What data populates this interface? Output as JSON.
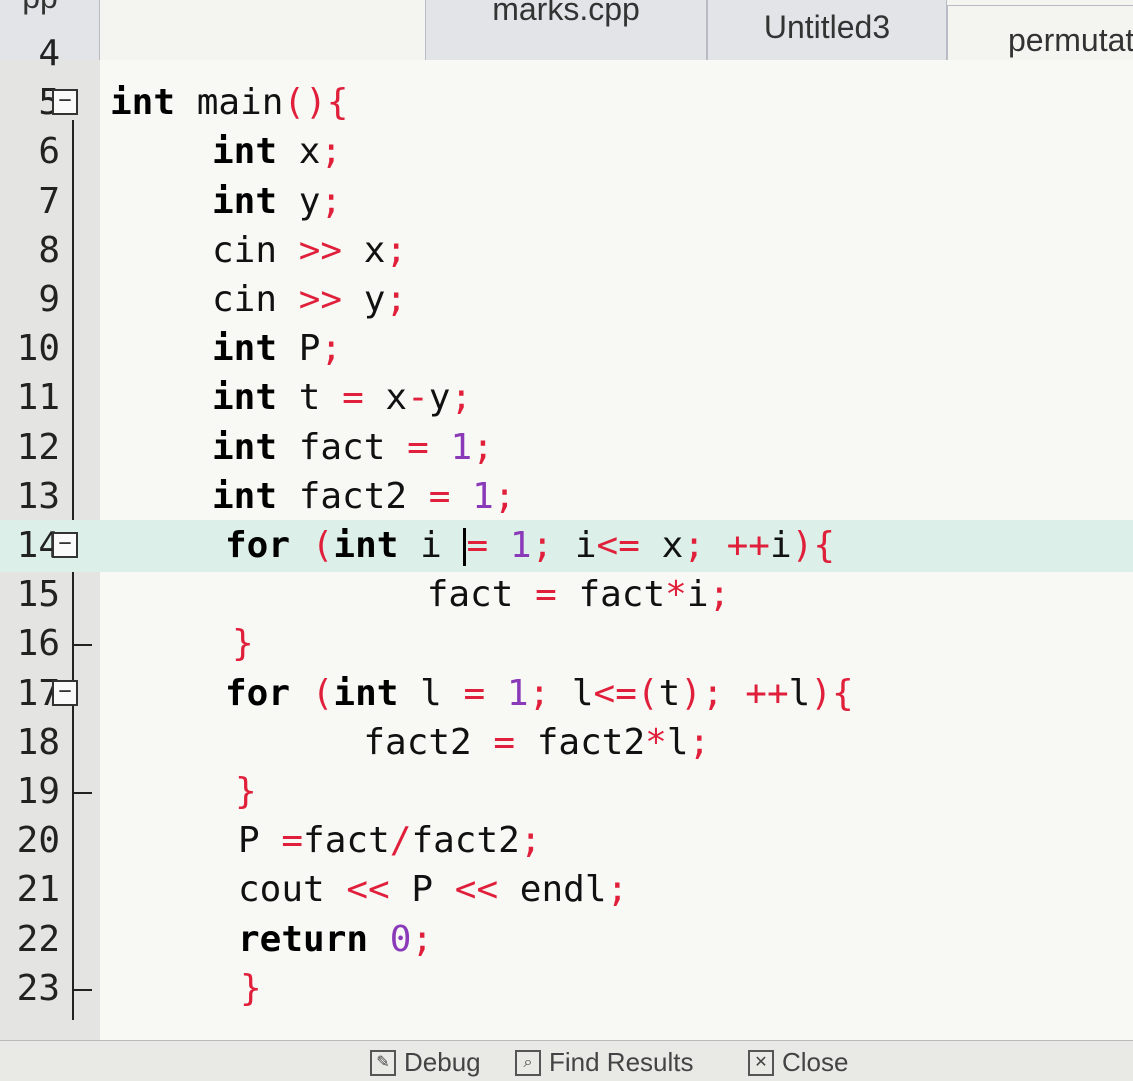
{
  "tabs": [
    "pp",
    "marks.cpp",
    "Untitled3",
    "permutat"
  ],
  "editor": {
    "lines": [
      {
        "n": "4",
        "parts": []
      },
      {
        "n": "5",
        "fold": "−",
        "parts": [
          [
            "kw",
            "int"
          ],
          [
            "plain",
            " main"
          ],
          [
            "sym",
            "(){"
          ]
        ]
      },
      {
        "n": "6",
        "parts": [
          [
            "kw",
            "int"
          ],
          [
            "plain",
            " x"
          ],
          [
            "sym",
            ";"
          ]
        ]
      },
      {
        "n": "7",
        "parts": [
          [
            "kw",
            "int"
          ],
          [
            "plain",
            " y"
          ],
          [
            "sym",
            ";"
          ]
        ]
      },
      {
        "n": "8",
        "parts": [
          [
            "plain",
            "cin "
          ],
          [
            "sym",
            ">>"
          ],
          [
            "plain",
            " x"
          ],
          [
            "sym",
            ";"
          ]
        ]
      },
      {
        "n": "9",
        "parts": [
          [
            "plain",
            "cin "
          ],
          [
            "sym",
            ">>"
          ],
          [
            "plain",
            " y"
          ],
          [
            "sym",
            ";"
          ]
        ]
      },
      {
        "n": "10",
        "parts": [
          [
            "kw",
            "int"
          ],
          [
            "plain",
            " P"
          ],
          [
            "sym",
            ";"
          ]
        ]
      },
      {
        "n": "11",
        "parts": [
          [
            "kw",
            "int"
          ],
          [
            "plain",
            " t "
          ],
          [
            "sym",
            "="
          ],
          [
            "plain",
            " x"
          ],
          [
            "sym",
            "-"
          ],
          [
            "plain",
            "y"
          ],
          [
            "sym",
            ";"
          ]
        ]
      },
      {
        "n": "12",
        "parts": [
          [
            "kw",
            "int"
          ],
          [
            "plain",
            " fact "
          ],
          [
            "sym",
            "="
          ],
          [
            "num",
            " 1"
          ],
          [
            "sym",
            ";"
          ]
        ]
      },
      {
        "n": "13",
        "parts": [
          [
            "kw",
            "int"
          ],
          [
            "plain",
            " fact2 "
          ],
          [
            "sym",
            "="
          ],
          [
            "num",
            " 1"
          ],
          [
            "sym",
            ";"
          ]
        ]
      },
      {
        "n": "14",
        "fold": "−",
        "current": true,
        "parts": [
          [
            "kw",
            "for"
          ],
          [
            "sym",
            " ("
          ],
          [
            "kw",
            "int"
          ],
          [
            "plain",
            " i "
          ],
          [
            "caret",
            ""
          ],
          [
            "sym",
            "="
          ],
          [
            "num",
            " 1"
          ],
          [
            "sym",
            ";"
          ],
          [
            "plain",
            " i"
          ],
          [
            "sym",
            "<="
          ],
          [
            "plain",
            " x"
          ],
          [
            "sym",
            "; ++"
          ],
          [
            "plain",
            "i"
          ],
          [
            "sym",
            "){"
          ]
        ]
      },
      {
        "n": "15",
        "parts": [
          [
            "plain",
            "    fact "
          ],
          [
            "sym",
            "="
          ],
          [
            "plain",
            " fact"
          ],
          [
            "sym",
            "*"
          ],
          [
            "plain",
            "i"
          ],
          [
            "sym",
            ";"
          ]
        ]
      },
      {
        "n": "16",
        "tick": true,
        "parts": [
          [
            "sym",
            "}"
          ]
        ]
      },
      {
        "n": "17",
        "fold": "−",
        "parts": [
          [
            "kw",
            "for"
          ],
          [
            "sym",
            " ("
          ],
          [
            "kw",
            "int"
          ],
          [
            "plain",
            " l "
          ],
          [
            "sym",
            "="
          ],
          [
            "num",
            " 1"
          ],
          [
            "sym",
            "; "
          ],
          [
            "plain",
            "l"
          ],
          [
            "sym",
            "<=("
          ],
          [
            "plain",
            "t"
          ],
          [
            "sym",
            "); ++"
          ],
          [
            "plain",
            "l"
          ],
          [
            "sym",
            "){"
          ]
        ]
      },
      {
        "n": "18",
        "parts": [
          [
            "plain",
            "  fact2 "
          ],
          [
            "sym",
            "="
          ],
          [
            "plain",
            " fact2"
          ],
          [
            "sym",
            "*"
          ],
          [
            "plain",
            "l"
          ],
          [
            "sym",
            ";"
          ]
        ]
      },
      {
        "n": "19",
        "tick": true,
        "parts": [
          [
            "sym",
            "}"
          ]
        ]
      },
      {
        "n": "20",
        "parts": [
          [
            "plain",
            "P "
          ],
          [
            "sym",
            "="
          ],
          [
            "plain",
            "fact"
          ],
          [
            "sym",
            "/"
          ],
          [
            "plain",
            "fact2"
          ],
          [
            "sym",
            ";"
          ]
        ]
      },
      {
        "n": "21",
        "parts": [
          [
            "plain",
            "cout "
          ],
          [
            "sym",
            "<<"
          ],
          [
            "plain",
            " P "
          ],
          [
            "sym",
            "<<"
          ],
          [
            "plain",
            " endl"
          ],
          [
            "sym",
            ";"
          ]
        ]
      },
      {
        "n": "22",
        "parts": [
          [
            "kw",
            "return"
          ],
          [
            "num",
            " 0"
          ],
          [
            "sym",
            ";"
          ]
        ]
      },
      {
        "n": "23",
        "tick": true,
        "parts": [
          [
            "sym",
            "}"
          ]
        ]
      }
    ]
  },
  "bottom": {
    "debug": "Debug",
    "find_results": "Find Results",
    "close": "Close"
  }
}
